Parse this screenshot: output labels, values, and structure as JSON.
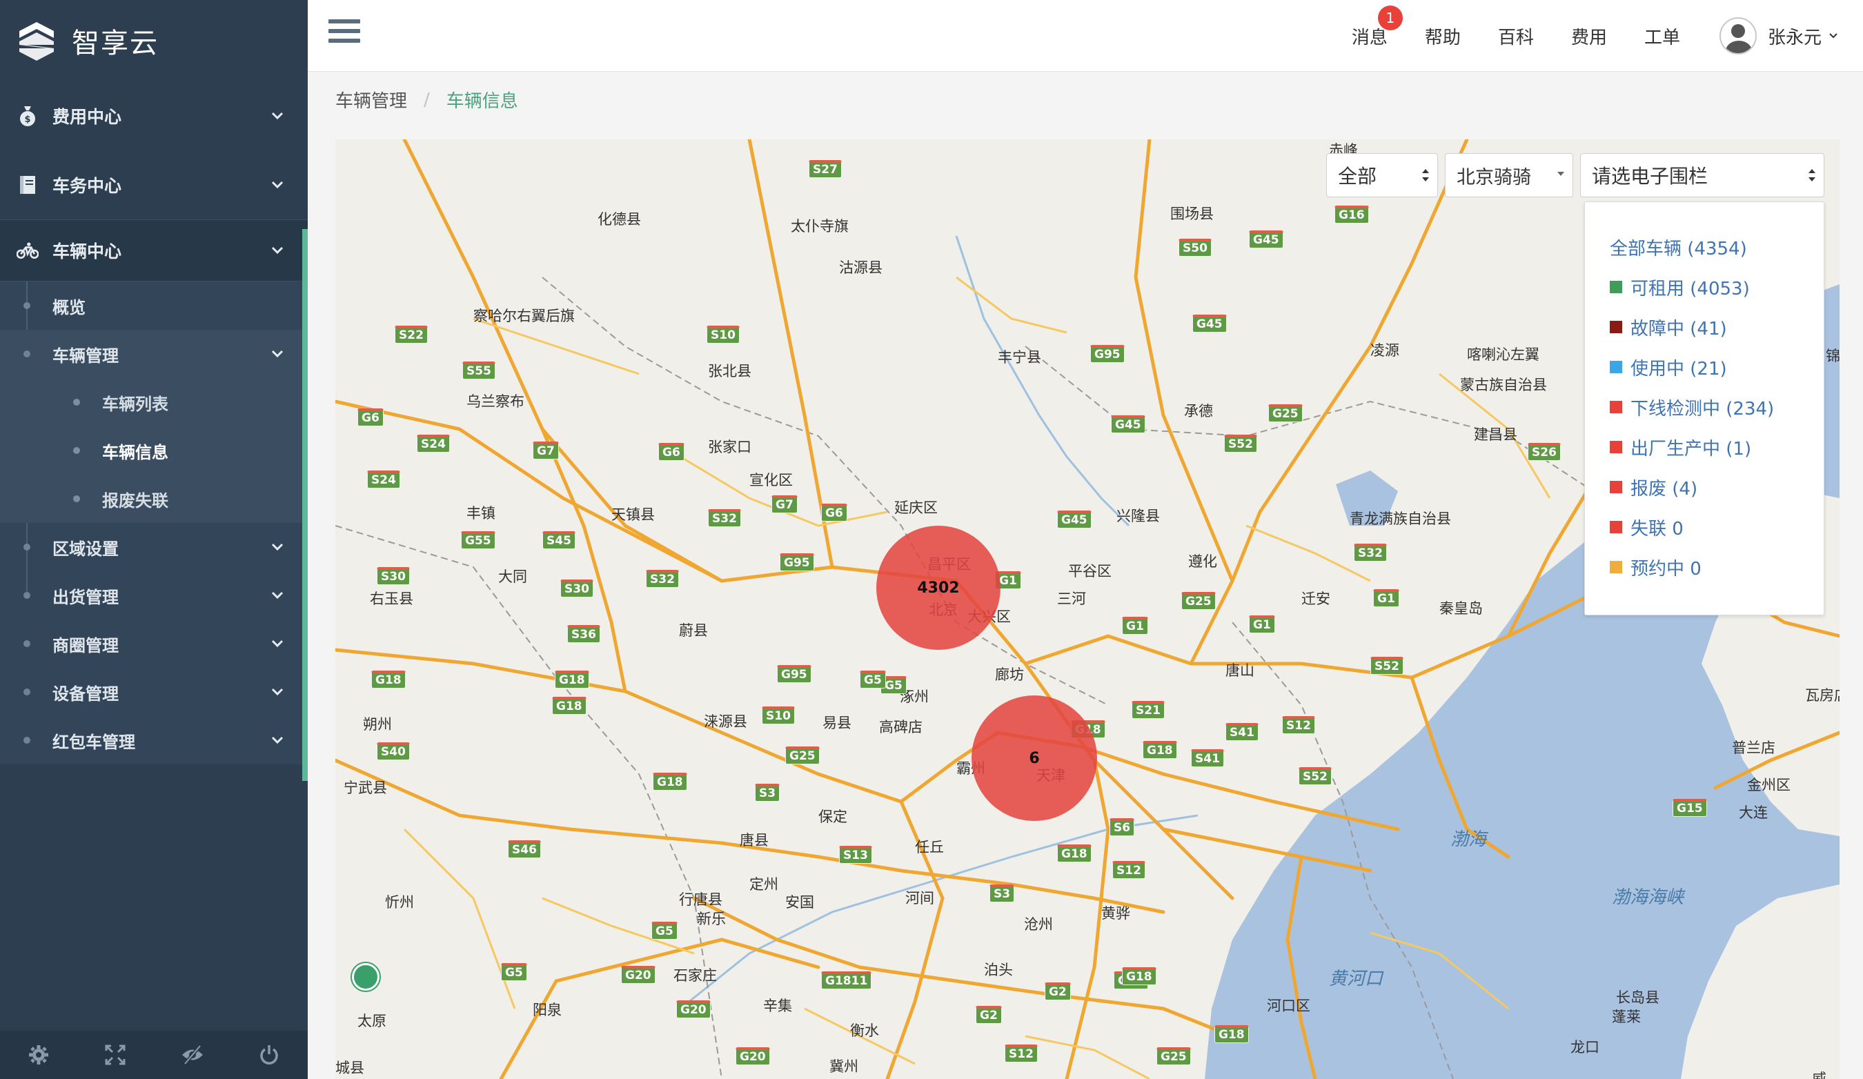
{
  "brand": {
    "name": "智享云"
  },
  "sidebar": {
    "top_items": [
      {
        "label": "费用中心",
        "icon": "money-bag-icon"
      },
      {
        "label": "车务中心",
        "icon": "book-icon"
      },
      {
        "label": "车辆中心",
        "icon": "bicycle-icon"
      }
    ],
    "vehicle_center": {
      "overview": "概览",
      "vehicle_management": "车辆管理",
      "vehicle_list": "车辆列表",
      "vehicle_info": "车辆信息",
      "scrap_lost": "报废失联",
      "region_settings": "区域设置",
      "shipping_management": "出货管理",
      "business_circle": "商圈管理",
      "device_management": "设备管理",
      "red_packet_management": "红包车管理"
    },
    "footer_icons": [
      "settings-icon",
      "fullscreen-icon",
      "eye-slash-icon",
      "power-icon"
    ]
  },
  "header": {
    "nav": {
      "messages": "消息",
      "message_badge": "1",
      "help": "帮助",
      "wiki": "百科",
      "fees": "费用",
      "tickets": "工单"
    },
    "user": {
      "name": "张永元"
    }
  },
  "breadcrumb": {
    "parent": "车辆管理",
    "current": "车辆信息"
  },
  "filters": {
    "status_select": "全部",
    "company_select": "北京骑骑",
    "fence_placeholder": "请选电子围栏"
  },
  "legend": [
    {
      "label": "全部车辆 (4354)",
      "color": ""
    },
    {
      "label": "可租用 (4053)",
      "color": "#3f9c5b"
    },
    {
      "label": "故障中 (41)",
      "color": "#8b1a14"
    },
    {
      "label": "使用中 (21)",
      "color": "#3aa6e8"
    },
    {
      "label": "下线检测中 (234)",
      "color": "#e8413a"
    },
    {
      "label": "出厂生产中 (1)",
      "color": "#e8413a"
    },
    {
      "label": "报废 (4)",
      "color": "#e8413a"
    },
    {
      "label": "失联 0",
      "color": "#e8413a"
    },
    {
      "label": "预约中 0",
      "color": "#f0ad3b"
    }
  ],
  "map": {
    "clusters": [
      {
        "label": "4302"
      },
      {
        "label": "6"
      }
    ],
    "cities": [
      {
        "name": "赤峰"
      },
      {
        "name": "化德县"
      },
      {
        "name": "太仆寺旗"
      },
      {
        "name": "沽源县"
      },
      {
        "name": "围场县"
      },
      {
        "name": "察哈尔右翼后旗"
      },
      {
        "name": "张北县"
      },
      {
        "name": "丰宁县"
      },
      {
        "name": "凌源"
      },
      {
        "name": "喀喇沁左翼"
      },
      {
        "name": "蒙古族自治县"
      },
      {
        "name": "乌兰察布"
      },
      {
        "name": "承德"
      },
      {
        "name": "建昌县"
      },
      {
        "name": "张家口"
      },
      {
        "name": "宣化区"
      },
      {
        "name": "丰镇"
      },
      {
        "name": "天镇县"
      },
      {
        "name": "延庆区"
      },
      {
        "name": "兴隆县"
      },
      {
        "name": "青龙满族自治县"
      },
      {
        "name": "大同"
      },
      {
        "name": "平谷区"
      },
      {
        "name": "遵化"
      },
      {
        "name": "右玉县"
      },
      {
        "name": "蔚县"
      },
      {
        "name": "三河"
      },
      {
        "name": "迁安"
      },
      {
        "name": "秦皇岛"
      },
      {
        "name": "大兴区"
      },
      {
        "name": "廊坊"
      },
      {
        "name": "唐山"
      },
      {
        "name": "涿州"
      },
      {
        "name": "易县"
      },
      {
        "name": "涞源县"
      },
      {
        "name": "高碑店"
      },
      {
        "name": "朔州"
      },
      {
        "name": "宁武县"
      },
      {
        "name": "霸州"
      },
      {
        "name": "天津"
      },
      {
        "name": "保定"
      },
      {
        "name": "唐县"
      },
      {
        "name": "任丘"
      },
      {
        "name": "定州"
      },
      {
        "name": "行唐县"
      },
      {
        "name": "新乐"
      },
      {
        "name": "安国"
      },
      {
        "name": "河间"
      },
      {
        "name": "黄骅"
      },
      {
        "name": "忻州"
      },
      {
        "name": "沧州"
      },
      {
        "name": "石家庄"
      },
      {
        "name": "泊头"
      },
      {
        "name": "阳泉"
      },
      {
        "name": "辛集"
      },
      {
        "name": "太原"
      },
      {
        "name": "衡水"
      },
      {
        "name": "冀州"
      },
      {
        "name": "城县"
      },
      {
        "name": "河口区"
      },
      {
        "name": "长岛县"
      },
      {
        "name": "蓬莱"
      },
      {
        "name": "龙口"
      },
      {
        "name": "大连"
      },
      {
        "name": "金州区"
      },
      {
        "name": "普兰店"
      },
      {
        "name": "瓦房店"
      },
      {
        "name": "朝"
      },
      {
        "name": "锦"
      },
      {
        "name": "威"
      },
      {
        "name": "北京"
      },
      {
        "name": "昌平区"
      }
    ],
    "seas": [
      {
        "name": "渤海"
      },
      {
        "name": "渤海海峡"
      },
      {
        "name": "黄河口"
      }
    ],
    "shields": [
      "S27",
      "G16",
      "S50",
      "G45",
      "G45",
      "S22",
      "S10",
      "G95",
      "S55",
      "G25",
      "G6",
      "G7",
      "G6",
      "S24",
      "S52",
      "G45",
      "S26",
      "S24",
      "G7",
      "G6",
      "S32",
      "G45",
      "G55",
      "S45",
      "G95",
      "S32",
      "S30",
      "S30",
      "S32",
      "G1",
      "S36",
      "G25",
      "G1",
      "G1",
      "G18",
      "G18",
      "G18",
      "G5",
      "G95",
      "G5",
      "G1",
      "S52",
      "S10",
      "S21",
      "G18",
      "S40",
      "G18",
      "G18",
      "S41",
      "S12",
      "S52",
      "S3",
      "S6",
      "G25",
      "S41",
      "G15",
      "S46",
      "S13",
      "G18",
      "S12",
      "S3",
      "G5",
      "G5",
      "G20",
      "G1811",
      "G18",
      "G20",
      "G2",
      "G2",
      "G18",
      "S12",
      "G20",
      "G25",
      "G18"
    ]
  }
}
